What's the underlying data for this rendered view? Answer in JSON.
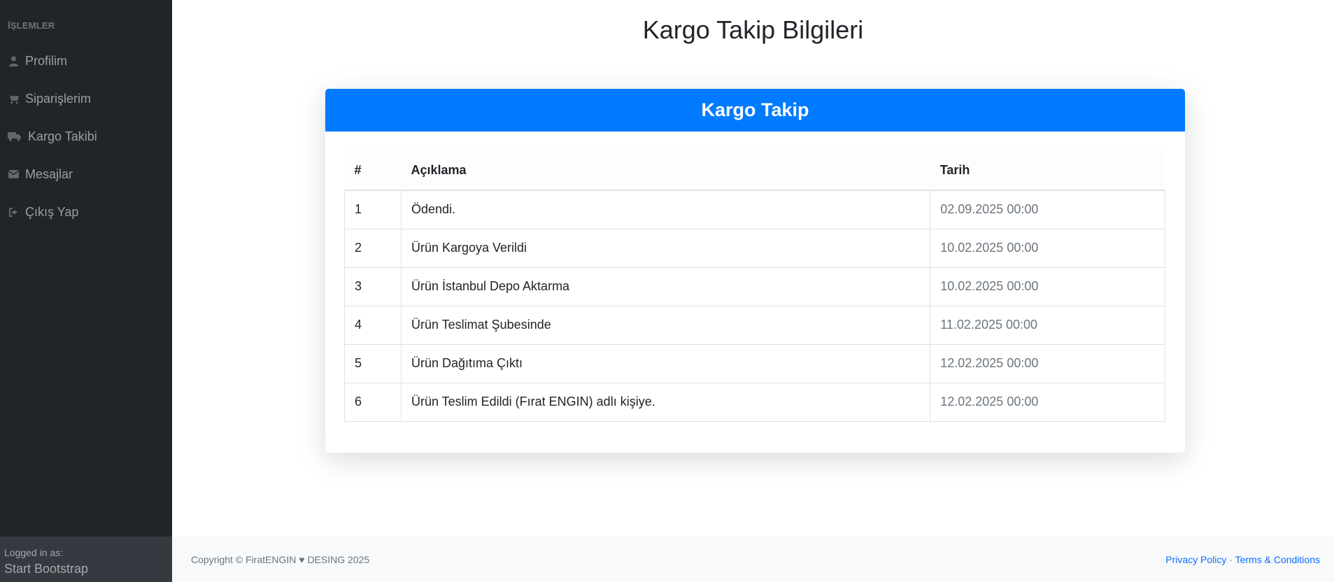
{
  "sidebar": {
    "heading": "İŞLEMLER",
    "items": [
      {
        "label": "Profilim",
        "icon": "user-icon"
      },
      {
        "label": "Siparişlerim",
        "icon": "cart-icon"
      },
      {
        "label": "Kargo Takibi",
        "icon": "truck-icon"
      },
      {
        "label": "Mesajlar",
        "icon": "envelope-icon"
      },
      {
        "label": "Çıkış Yap",
        "icon": "sign-out-icon"
      }
    ],
    "footer": {
      "logged_in_label": "Logged in as:",
      "user": "Start Bootstrap"
    }
  },
  "page": {
    "title": "Kargo Takip Bilgileri"
  },
  "card": {
    "header": "Kargo Takip"
  },
  "table": {
    "headers": [
      "#",
      "Açıklama",
      "Tarih"
    ],
    "rows": [
      {
        "no": "1",
        "desc": "Ödendi.",
        "date": "02.09.2025 00:00"
      },
      {
        "no": "2",
        "desc": "Ürün Kargoya Verildi",
        "date": "10.02.2025 00:00"
      },
      {
        "no": "3",
        "desc": "Ürün İstanbul Depo Aktarma",
        "date": "10.02.2025 00:00"
      },
      {
        "no": "4",
        "desc": "Ürün Teslimat Şubesinde",
        "date": "11.02.2025 00:00"
      },
      {
        "no": "5",
        "desc": "Ürün Dağıtıma Çıktı",
        "date": "12.02.2025 00:00"
      },
      {
        "no": "6",
        "desc": "Ürün Teslim Edildi (Fırat ENGIN) adlı kişiye.",
        "date": "12.02.2025 00:00"
      }
    ]
  },
  "footer": {
    "copyright": "Copyright © FiratENGIN ♥ DESING 2025",
    "privacy": "Privacy Policy",
    "separator": "·",
    "terms": "Terms & Conditions"
  },
  "colors": {
    "sidebar_bg": "#212529",
    "accent": "#007bff",
    "link": "#0d6efd"
  }
}
